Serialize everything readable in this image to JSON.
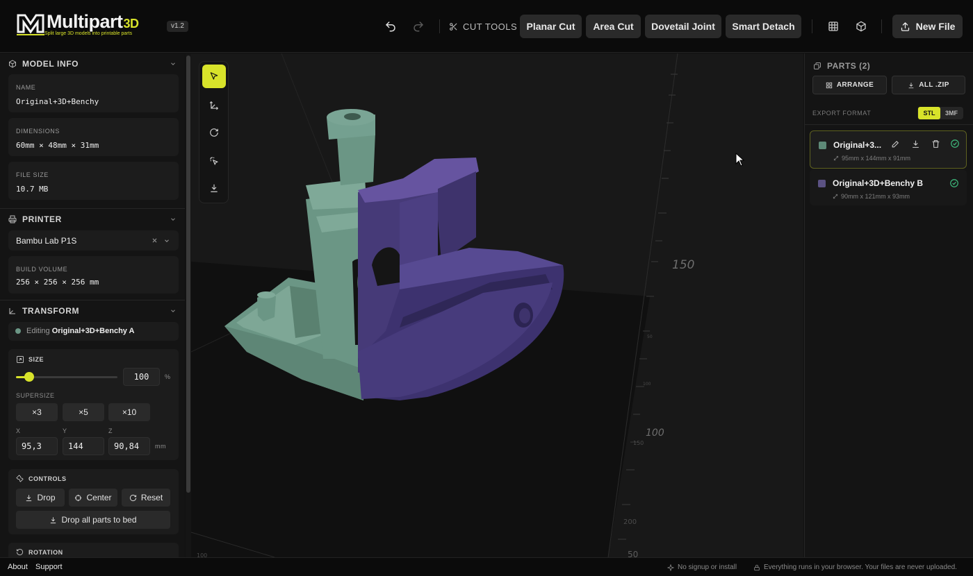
{
  "header": {
    "logo_title": "Multipart",
    "logo_suffix": "3D",
    "logo_tagline": "Split large 3D models into printable parts",
    "version": "v1.2",
    "cut_tools_label": "CUT TOOLS",
    "tools": [
      "Planar Cut",
      "Area Cut",
      "Dovetail Joint",
      "Smart Detach"
    ],
    "new_file_label": "New File"
  },
  "model_info": {
    "title": "MODEL INFO",
    "name_label": "NAME",
    "name_value": "Original+3D+Benchy",
    "dimensions_label": "DIMENSIONS",
    "dimensions_value": "60mm × 48mm × 31mm",
    "file_size_label": "FILE SIZE",
    "file_size_value": "10.7 MB"
  },
  "printer": {
    "title": "PRINTER",
    "selected": "Bambu Lab P1S",
    "build_volume_label": "BUILD VOLUME",
    "build_volume_value": "256 × 256 × 256 mm"
  },
  "transform": {
    "title": "TRANSFORM",
    "editing_prefix": "Editing",
    "editing_part": "Original+3D+Benchy A",
    "size_label": "SIZE",
    "size_value": "100",
    "size_unit": "%",
    "size_slider_fraction": 0.13,
    "supersize_label": "SUPERSIZE",
    "supersize_options": [
      "×3",
      "×5",
      "×10"
    ],
    "x_label": "X",
    "y_label": "Y",
    "z_label": "Z",
    "x_value": "95,3",
    "y_value": "144",
    "z_value": "90,84",
    "dim_unit": "mm"
  },
  "controls": {
    "title": "CONTROLS",
    "drop": "Drop",
    "center": "Center",
    "reset": "Reset",
    "drop_all": "Drop all parts to bed"
  },
  "rotation": {
    "title": "ROTATION"
  },
  "viewport": {
    "axis_labels": [
      "150",
      "100",
      "100",
      "50",
      "100",
      "150",
      "200",
      "50"
    ]
  },
  "parts": {
    "title": "PARTS (2)",
    "arrange": "ARRANGE",
    "all_zip": "ALL .ZIP",
    "export_format_label": "EXPORT FORMAT",
    "format_stl": "STL",
    "format_3mf": "3MF",
    "items": [
      {
        "name": "Original+3...",
        "dims": "95mm x 144mm x 91mm",
        "color": "#5e8a78"
      },
      {
        "name": "Original+3D+Benchy B",
        "dims": "90mm x 121mm x 93mm",
        "color": "#5b5283"
      }
    ]
  },
  "footer": {
    "about": "About",
    "support": "Support",
    "note1": "No signup or install",
    "note2": "Everything runs in your browser. Your files are never uploaded."
  },
  "colors": {
    "accent": "#d8e32a",
    "part_a": "#6b9685",
    "part_b": "#4b3f7f",
    "success": "#3fbf7f"
  }
}
